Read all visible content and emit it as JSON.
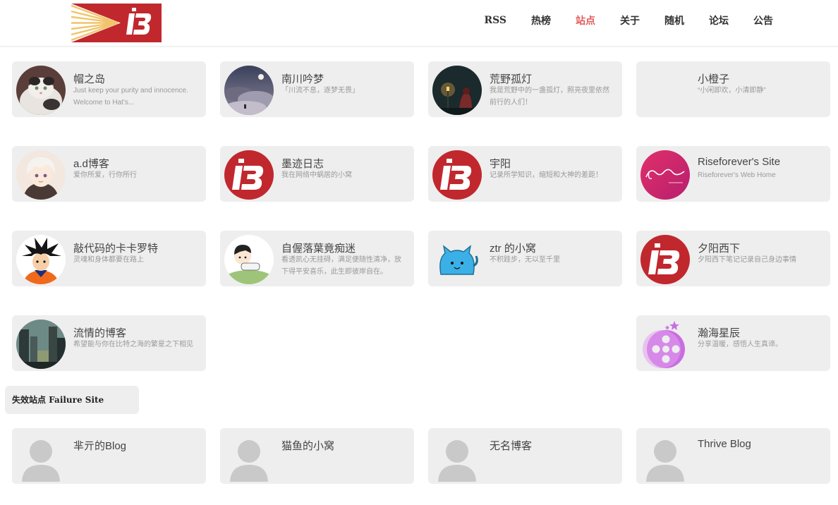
{
  "header": {
    "nav": [
      "RSS",
      "热榜",
      "站点",
      "关于",
      "随机",
      "论坛",
      "公告"
    ],
    "active_index": 2,
    "brand_colors": {
      "logo_red": "#c0282e",
      "logo_ray": "#f2c46a",
      "active_nav": "#e25a5a"
    }
  },
  "sites": [
    {
      "title": "帽之岛",
      "desc": "Just keep your purity and innocence. Welcome to Hat's...",
      "avatar": "cat-photo-icon"
    },
    {
      "title": "南川吟梦",
      "desc": "「川流不息，逐梦无畏」",
      "avatar": "night-sky-photo-icon"
    },
    {
      "title": "荒野孤灯",
      "desc": "我是荒野中的一盏孤灯，照亮夜里依然前行的人们！",
      "avatar": "lamp-photo-icon"
    },
    {
      "title": "小橙子",
      "desc": "“小闲即欢，小清即静”",
      "avatar": "blank-icon"
    },
    {
      "title": "a.d博客",
      "desc": "爱你所爱，行你所行",
      "avatar": "anime-boy-icon"
    },
    {
      "title": "墨迹日志",
      "desc": "我在网络中蜗居的小窝",
      "avatar": "ib-logo-icon"
    },
    {
      "title": "宇阳",
      "desc": "记录所学知识，缩短和大神的差距！",
      "avatar": "ib-logo-icon"
    },
    {
      "title": "Riseforever's Site",
      "desc": "Riseforever's Web Home",
      "avatar": "riseforever-logo-icon"
    },
    {
      "title": "敲代码的卡卡罗特",
      "desc": "灵魂和身体都要在路上",
      "avatar": "goku-icon"
    },
    {
      "title": "自偓落葉竟痴迷",
      "desc": "看透凯心无挂碍，满足便随性清净，放下得平安喜乐，此生即彼岸自在。",
      "avatar": "cartoon-boy-icon"
    },
    {
      "title": "ztr 的小窝",
      "desc": "不积跬步，无以至千里",
      "avatar": "blue-cat-icon"
    },
    {
      "title": "夕阳西下",
      "desc": "夕阳西下笔记记录自己身边事情",
      "avatar": "ib-logo-icon"
    },
    {
      "title": "流情的博客",
      "desc": "希望能与你在比特之海的繁星之下相见",
      "avatar": "city-photo-icon"
    },
    {
      "title": "瀚海星辰",
      "desc": "分享温暖，感悟人生真谛。",
      "avatar": "film-reel-icon"
    }
  ],
  "failure": {
    "section_title": "失效站点 Failure Site",
    "sites": [
      {
        "title": "芈亓的Blog",
        "avatar": "default-user-icon"
      },
      {
        "title": "猫鱼的小窝",
        "avatar": "default-user-icon"
      },
      {
        "title": "无名博客",
        "avatar": "default-user-icon"
      },
      {
        "title": "Thrive Blog",
        "avatar": "default-user-icon"
      }
    ]
  }
}
